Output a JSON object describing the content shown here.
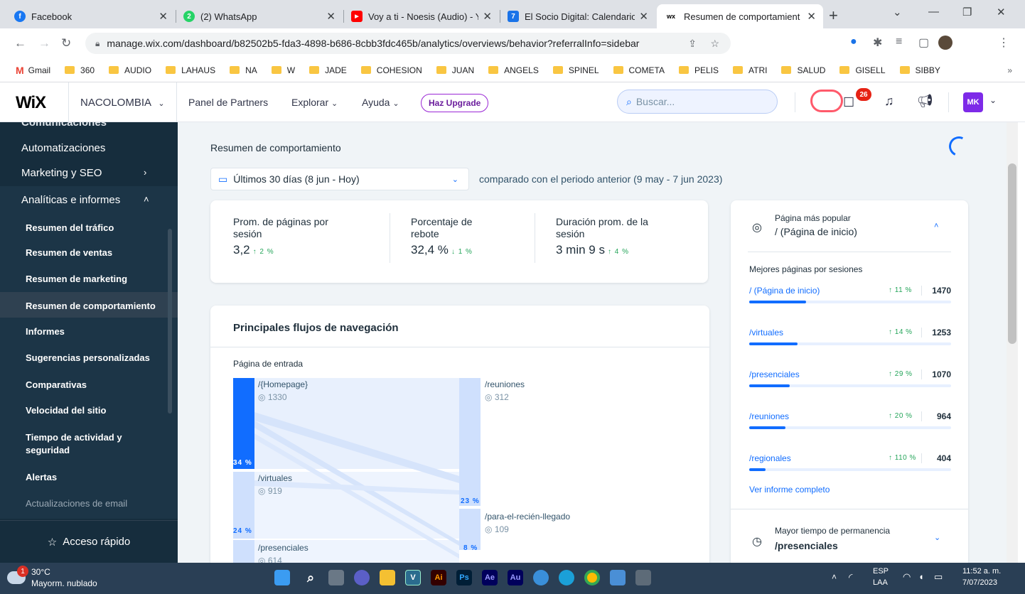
{
  "browser": {
    "tabs": [
      {
        "title": "Facebook",
        "icon": "facebook-icon",
        "color": "#1877f2",
        "glyph": "f"
      },
      {
        "title": "(2) WhatsApp",
        "icon": "whatsapp-icon",
        "color": "#25d366",
        "glyph": "2"
      },
      {
        "title": "Voy a ti - Noesis (Audio) - Yo",
        "icon": "youtube-icon",
        "color": "#ff0000",
        "glyph": "▶"
      },
      {
        "title": "El Socio Digital: Calendario -",
        "icon": "calendar-icon",
        "color": "#1a73e8",
        "glyph": "7"
      },
      {
        "title": "Resumen de comportamient",
        "icon": "wix-favicon-icon",
        "color": "#000000",
        "glyph": "w"
      }
    ],
    "url": "manage.wix.com/dashboard/b82502b5-fda3-4898-b686-8cbb3fdc465b/analytics/overviews/behavior?referralInfo=sidebar",
    "bookmarks": [
      "Gmail",
      "360",
      "AUDIO",
      "LAHAUS",
      "NA",
      "W",
      "JADE",
      "COHESION",
      "JUAN",
      "ANGELS",
      "SPINEL",
      "COMETA",
      "PELIS",
      "ATRI",
      "SALUD",
      "GISELL",
      "SIBBY"
    ],
    "bookmarks_more": "»"
  },
  "header": {
    "logo": "WiX",
    "site": "NACOLOMBIA",
    "links": {
      "partners": "Panel de Partners",
      "explore": "Explorar",
      "help": "Ayuda"
    },
    "upgrade": "Haz Upgrade",
    "search_placeholder": "Buscar...",
    "notifications": "26",
    "avatar": "MK"
  },
  "sidebar": {
    "cut_item": "Comunicaciones",
    "top_items": [
      {
        "label": "Automatizaciones"
      },
      {
        "label": "Marketing y SEO",
        "chevron": "›"
      },
      {
        "label": "Analíticas e informes",
        "chevron": "˄"
      }
    ],
    "sub_items": [
      "Resumen del tráfico",
      "Resumen de ventas",
      "Resumen de marketing",
      "Resumen de comportamiento",
      "Informes",
      "Sugerencias personalizadas",
      "Comparativas",
      "Velocidad del sitio",
      "Tiempo de actividad y",
      "seguridad",
      "Alertas",
      "Actualizaciones de email"
    ],
    "quick_access": "Acceso rápido"
  },
  "main": {
    "title": "Resumen de comportamiento",
    "date_range": "Últimos 30 días (8 jun - Hoy)",
    "compare": "comparado con el periodo anterior (9 may - 7 jun 2023)",
    "kpis": [
      {
        "l1": "Prom. de páginas por",
        "l2": "sesión",
        "value": "3,2",
        "change": "↑ 2 %",
        "dir": "up"
      },
      {
        "l1": "Porcentaje de",
        "l2": "rebote",
        "value": "32,4 %",
        "change": "↓ 1 %",
        "dir": "up"
      },
      {
        "l1": "Duración prom. de la",
        "l2": "sesión",
        "value": "3 min 9 s",
        "change": "↑ 4 %",
        "dir": "up"
      }
    ],
    "flows": {
      "title": "Principales flujos de navegación",
      "entry_label": "Página de entrada",
      "left_nodes": [
        {
          "label": "/{Homepage}",
          "views": "1330",
          "pct": "34 %"
        },
        {
          "label": "/virtuales",
          "views": "919",
          "pct": "24 %"
        },
        {
          "label": "/presenciales",
          "views": "614"
        }
      ],
      "right_nodes": [
        {
          "label": "/reuniones",
          "views": "312",
          "pct": "23 %"
        },
        {
          "label": "/para-el-recién-llegado",
          "views": "109",
          "pct": "8 %"
        }
      ]
    }
  },
  "right_panel": {
    "popular_small": "Página más popular",
    "popular": "/ (Página de inicio)",
    "best_pages_title": "Mejores páginas por sesiones",
    "pages": [
      {
        "path": "/ (Página de inicio)",
        "change": "↑ 11 %",
        "sessions": "1470",
        "share": 0.28
      },
      {
        "path": "/virtuales",
        "change": "↑ 14 %",
        "sessions": "1253",
        "share": 0.24
      },
      {
        "path": "/presenciales",
        "change": "↑ 29 %",
        "sessions": "1070",
        "share": 0.2
      },
      {
        "path": "/reuniones",
        "change": "↑ 20 %",
        "sessions": "964",
        "share": 0.18
      },
      {
        "path": "/regionales",
        "change": "↑ 110 %",
        "sessions": "404",
        "share": 0.08
      }
    ],
    "full_report": "Ver informe completo",
    "longest_small": "Mayor tiempo de permanencia",
    "longest": "/presenciales"
  },
  "taskbar": {
    "temp": "30°C",
    "weather": "Mayorm. nublado",
    "weather_badge": "1",
    "lang1": "ESP",
    "lang2": "LAA",
    "time": "11:52 a. m.",
    "date": "7/07/2023"
  },
  "colors": {
    "accent": "#116dff",
    "sidebar": "#162d3d",
    "positive": "#25a55a"
  }
}
